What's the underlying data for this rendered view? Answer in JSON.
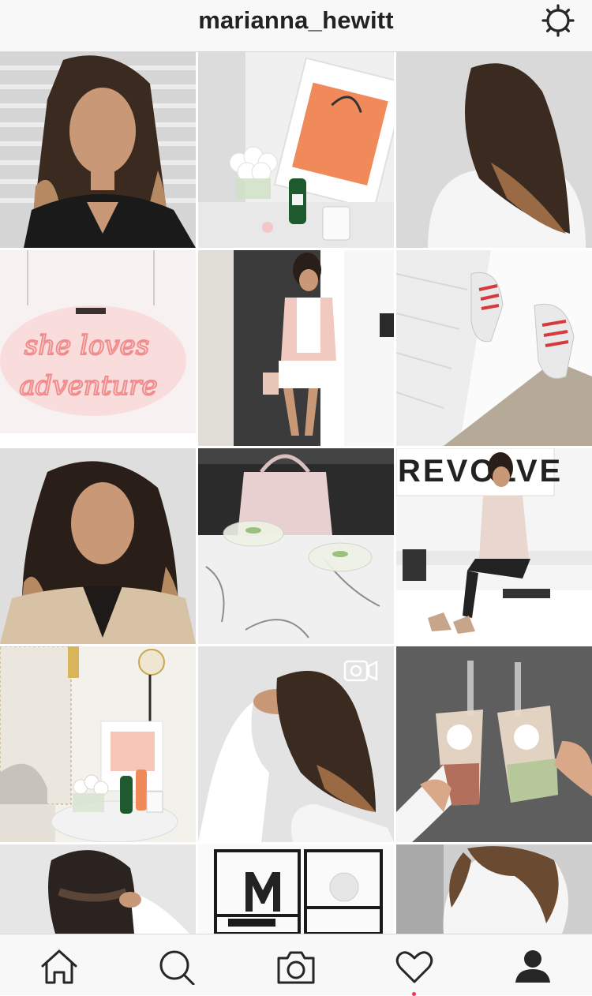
{
  "header": {
    "username": "marianna_hewitt",
    "settings_icon": "gear-icon"
  },
  "posts": [
    {
      "subject": "portrait-brunette-woman",
      "palette": [
        "#d9d9d9",
        "#1a1a1a",
        "#c89a73"
      ]
    },
    {
      "subject": "framed-shopping-bag-roses",
      "palette": [
        "#f2f2f2",
        "#f08a5a",
        "#ffffff"
      ]
    },
    {
      "subject": "ombre-hair-back",
      "palette": [
        "#dcdcdc",
        "#3a2a20",
        "#f5f5f5"
      ]
    },
    {
      "subject": "neon-sign",
      "palette": [
        "#fbeaea",
        "#f28b8b",
        "#ffffff"
      ],
      "text_art": [
        "she loves",
        "adventure"
      ]
    },
    {
      "subject": "woman-standing-doorway",
      "palette": [
        "#e8e8e8",
        "#333333",
        "#f2c9c0"
      ]
    },
    {
      "subject": "sneakers-on-rug",
      "palette": [
        "#f0f0f0",
        "#b5aa97",
        "#d63a3a"
      ]
    },
    {
      "subject": "portrait-trench-coat",
      "palette": [
        "#e0e0e0",
        "#d8c2a6",
        "#2a1f18"
      ]
    },
    {
      "subject": "handbag-and-drinks",
      "palette": [
        "#2b2b2b",
        "#e8cfd0",
        "#f0f0f0"
      ]
    },
    {
      "subject": "woman-seated-store",
      "palette": [
        "#f5f5f5",
        "#222222",
        "#e9d6cf"
      ],
      "text_art": [
        "REVOLVE"
      ]
    },
    {
      "subject": "bedroom-nightstand",
      "palette": [
        "#f3f1ec",
        "#f08a5a",
        "#c9a74a"
      ]
    },
    {
      "subject": "hair-video",
      "palette": [
        "#e3e3e3",
        "#3a2a20",
        "#ffffff"
      ],
      "badge": "video-camera-icon"
    },
    {
      "subject": "bubble-tea-cups",
      "palette": [
        "#5e5e5e",
        "#e8d8c7",
        "#b26f5c"
      ]
    },
    {
      "subject": "braided-hair",
      "palette": [
        "#e6e6e6",
        "#2b2320",
        "#ffffff"
      ]
    },
    {
      "subject": "shelf-letter-m",
      "palette": [
        "#fafafa",
        "#1a1a1a",
        "#e6e6e6"
      ]
    },
    {
      "subject": "wavy-hair-white-top",
      "palette": [
        "#cfcfcf",
        "#6b4a32",
        "#f5f5f5"
      ]
    }
  ],
  "tabbar": {
    "tabs": [
      "home-icon",
      "search-icon",
      "camera-icon",
      "heart-icon",
      "profile-icon"
    ],
    "active": "profile-icon",
    "notification_color": "#e8385a"
  },
  "colors": {
    "bar_background": "#f8f8f8",
    "divider": "#d8d8d8",
    "icon": "#262626"
  }
}
